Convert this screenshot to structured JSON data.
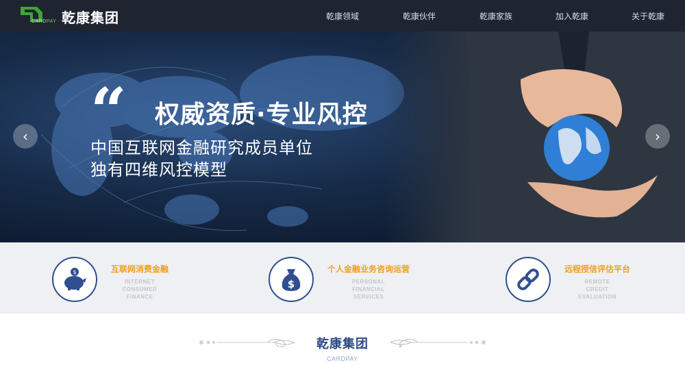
{
  "header": {
    "logo_sub_1": "CARD",
    "logo_sub_2": "PAY",
    "logo_title": "乾康集团",
    "nav": [
      "乾康领域",
      "乾康伙伴",
      "乾康家族",
      "加入乾康",
      "关于乾康"
    ]
  },
  "hero": {
    "quote_mark": "“",
    "title": "权威资质·专业风控",
    "line1": "中国互联网金融研究成员单位",
    "line2": "独有四维风控模型",
    "prev_glyph": "‹",
    "next_glyph": "›"
  },
  "services": [
    {
      "title": "互联网消费金融",
      "en": [
        "INTERNET",
        "CONSUMER",
        "FINANCE"
      ],
      "icon": "piggy-bank-icon"
    },
    {
      "title": "个人金融业务咨询运营",
      "en": [
        "PERSONAL",
        "FINANCIAL",
        "SERVICES"
      ],
      "icon": "money-bag-icon"
    },
    {
      "title": "远程授信评估平台",
      "en": [
        "REMOTE",
        "CREDIT",
        "EVALUATION"
      ],
      "icon": "chain-link-icon"
    }
  ],
  "brand": {
    "title": "乾康集团",
    "subtitle": "CARDPAY"
  },
  "colors": {
    "nav_bg": "#1e2430",
    "accent_orange": "#f0a01e",
    "accent_blue": "#2f4f8f",
    "logo_green": "#3fa535"
  }
}
